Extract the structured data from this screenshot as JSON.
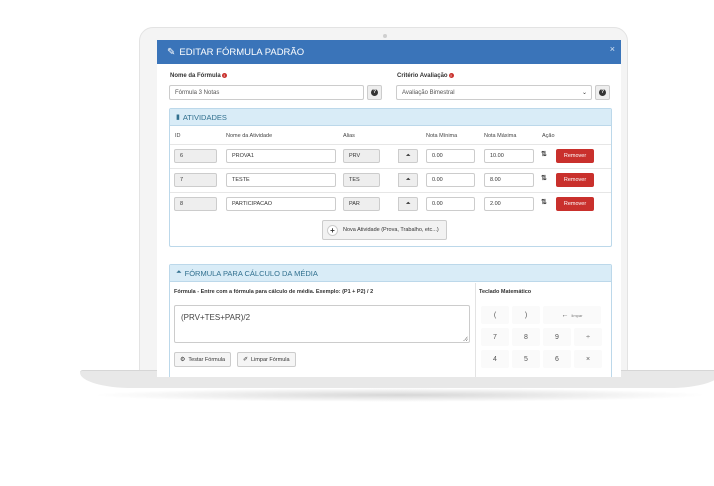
{
  "modal": {
    "title": "EDITAR FÓRMULA PADRÃO",
    "close": "×"
  },
  "form": {
    "nome_label": "Nome da Fórmula",
    "nome_value": "Fórmula 3 Notas",
    "criterio_label": "Critério Avaliação",
    "criterio_value": "Avaliação Bimestral",
    "help_glyph": "?",
    "required_glyph": "!"
  },
  "atividades": {
    "title": "ATIVIDADES",
    "headers": [
      "ID",
      "Nome da Atividade",
      "Alias",
      "Nota Mínima",
      "Nota Máxima",
      "Ação"
    ],
    "rows": [
      {
        "id": "6",
        "nome": "PROVA1",
        "alias": "PRV",
        "min": "0.00",
        "max": "10.00",
        "action": "Remover"
      },
      {
        "id": "7",
        "nome": "TESTE",
        "alias": "TES",
        "min": "0.00",
        "max": "8.00",
        "action": "Remover"
      },
      {
        "id": "8",
        "nome": "PARTICIPACAO",
        "alias": "PAR",
        "min": "0.00",
        "max": "2.00",
        "action": "Remover"
      }
    ],
    "new_button": "Nova Atividade (Prova, Trabalho, etc...)"
  },
  "formula": {
    "title": "FÓRMULA PARA CÁLCULO DA MÉDIA",
    "label": "Fórmula - Entre com a fórmula para cálculo de média. Exemplo: (P1 + P2) / 2",
    "value": "(PRV+TES+PAR)/2",
    "test_button": "Testar Fórmula",
    "clear_button": "Limpar Fórmula"
  },
  "keypad": {
    "label": "Teclado Matemático",
    "keys": [
      "(",
      ")",
      "←",
      "7",
      "8",
      "9",
      "÷",
      "4",
      "5",
      "6",
      "×"
    ],
    "backspace_caption": "limpar"
  },
  "colors": {
    "header_blue": "#3a74b9",
    "panel_head": "#d9ecf7",
    "danger": "#c9302c"
  }
}
